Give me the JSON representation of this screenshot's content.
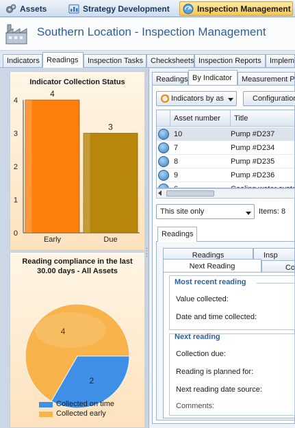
{
  "module_tabs": [
    {
      "label": "Assets",
      "icon": "gears-icon"
    },
    {
      "label": "Strategy Development",
      "icon": "strategy-icon"
    },
    {
      "label": "Inspection Management",
      "icon": "inspection-icon",
      "active": true
    }
  ],
  "header": {
    "title": "Southern Location - Inspection Management"
  },
  "main_tabs": [
    "Indicators",
    "Readings",
    "Inspection Tasks",
    "Checksheets",
    "Inspection Reports",
    "Impleme"
  ],
  "left": {
    "status_title": "Indicator Collection Status",
    "compliance_title_line1": "Reading compliance in the last",
    "compliance_title_line2": "30.00 days - All Assets"
  },
  "chart_data": [
    {
      "type": "bar",
      "title": "Indicator Collection Status",
      "categories": [
        "Early",
        "Due"
      ],
      "values": [
        4,
        3
      ],
      "ylim": [
        0,
        4
      ],
      "yticks": [
        "0",
        "1",
        "2",
        "3",
        "4"
      ],
      "data_labels": [
        "4",
        "3"
      ],
      "colors": [
        "#ff7f0e",
        "#b8860b"
      ],
      "grid": false,
      "legend": "none"
    },
    {
      "type": "pie",
      "title": "Reading compliance in the last 30.00 days - All Assets",
      "categories": [
        "Collected on time",
        "Collected early"
      ],
      "values": [
        2,
        4
      ],
      "data_labels": [
        "2",
        "4"
      ],
      "colors": [
        "#3f8fe6",
        "#f8b44a"
      ],
      "legend": "bottom"
    }
  ],
  "right": {
    "subtabs": [
      "Readings",
      "By Indicator",
      "Measurement Po"
    ],
    "view_dropdown": "Indicators by as",
    "config_button": "Configuration",
    "columns": [
      "Asset number",
      "Title"
    ],
    "rows": [
      {
        "asset": "10",
        "title": "Pump #D237"
      },
      {
        "asset": "7",
        "title": "Pump #D234"
      },
      {
        "asset": "8",
        "title": "Pump #D235"
      },
      {
        "asset": "9",
        "title": "Pump #D236"
      },
      {
        "asset": "6",
        "title": "Cooling water syste"
      }
    ],
    "site_filter": "This site only",
    "items_label": "Items: 8",
    "readings_tab": "Readings",
    "inner_tabs_row1": [
      "Readings",
      "Insp"
    ],
    "inner_tabs_row2": [
      "Next Reading",
      "Co"
    ],
    "most_recent": {
      "title": "Most recent reading",
      "value_collected": "Value collected:",
      "date_collected": "Date and time collected:"
    },
    "next_reading": {
      "title": "Next reading",
      "collection_due": "Collection due:",
      "planned_for": "Reading is planned for:",
      "date_source": "Next reading date source:",
      "comments": "Comments:"
    }
  }
}
